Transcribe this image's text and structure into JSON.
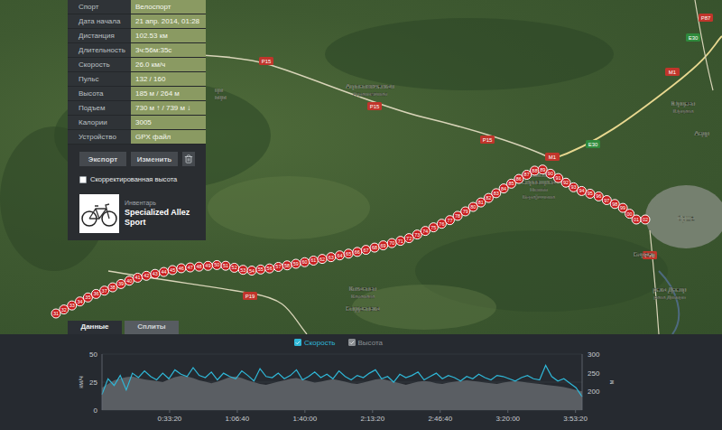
{
  "activity_panel": {
    "stats": [
      {
        "label": "Спорт",
        "value": "Велоспорт"
      },
      {
        "label": "Дата начала",
        "value": "21 апр. 2014, 01:28"
      },
      {
        "label": "Дистанция",
        "value": "102.53 км"
      },
      {
        "label": "Длительность",
        "value": "3ч:56м:35с"
      },
      {
        "label": "Скорость",
        "value": "26.0 км/ч"
      },
      {
        "label": "Пульс",
        "value": "132 / 160"
      },
      {
        "label": "Высота",
        "value": "185 м / 264 м"
      },
      {
        "label": "Подъем",
        "value": "730 м ↑ / 739 м ↓"
      },
      {
        "label": "Калории",
        "value": "3005"
      },
      {
        "label": "Устройство",
        "value": "GPX файл"
      }
    ],
    "buttons": [
      {
        "label": "Экспорт"
      },
      {
        "label": "Изменить"
      }
    ],
    "checkbox": {
      "label": "Скорректированная высота",
      "checked": false
    },
    "equipment": {
      "caption": "Инвентарь",
      "name": "Specialized Allez Sport"
    }
  },
  "map": {
    "markers": [
      "31",
      "32",
      "33",
      "34",
      "35",
      "36",
      "37",
      "38",
      "39",
      "40",
      "41",
      "42",
      "43",
      "44",
      "45",
      "46",
      "47",
      "48",
      "49",
      "50",
      "51",
      "52",
      "53",
      "54",
      "55",
      "56",
      "57",
      "58",
      "59",
      "60",
      "61",
      "62",
      "63",
      "64",
      "65",
      "66",
      "67",
      "68",
      "69",
      "70",
      "71",
      "72",
      "73",
      "74",
      "75",
      "76",
      "77",
      "78",
      "79",
      "80",
      "81",
      "82",
      "83",
      "84",
      "85",
      "86",
      "87",
      "88",
      "89",
      "90",
      "91",
      "92",
      "93",
      "94",
      "95",
      "96",
      "97",
      "98",
      "99",
      "00",
      "01",
      "02"
    ],
    "road_signs": [
      "P15",
      "P15",
      "P15",
      "P19",
      "M1",
      "M1",
      "E30",
      "E30",
      "P76",
      "P87"
    ],
    "places": [
      "Агрономическая",
      "Аграномічная",
      "Юрцево",
      "Юрцава",
      "Нижняя",
      "Вировщина",
      "Ніжняя",
      "Вераўшчына",
      "Коханово",
      "Каханава",
      "Богдановка",
      "Орша",
      "Барань",
      "река Днепр",
      "рака Дняпро",
      "Андр",
      "цы",
      "ьцы"
    ]
  },
  "tabs": [
    {
      "label": "Данные",
      "selected": true
    },
    {
      "label": "Сплиты",
      "selected": false
    }
  ],
  "chart": {
    "legend": [
      {
        "label": "Скорость",
        "checked": true,
        "color": "#2fb8d8"
      },
      {
        "label": "Высота",
        "checked": true,
        "color": "#8a8e92"
      }
    ],
    "left_axis": {
      "unit": "км/ч",
      "ticks": [
        "50",
        "25",
        "0"
      ]
    },
    "right_axis": {
      "unit": "м",
      "ticks": [
        "300",
        "250",
        "200"
      ]
    },
    "x_ticks": [
      "0:33:20",
      "1:06:40",
      "1:40:00",
      "2:13:20",
      "2:46:40",
      "3:20:00",
      "3:53:20"
    ],
    "speed": [
      14,
      28,
      22,
      31,
      18,
      33,
      29,
      35,
      30,
      27,
      33,
      28,
      36,
      32,
      30,
      38,
      31,
      29,
      34,
      27,
      33,
      30,
      28,
      35,
      31,
      26,
      37,
      30,
      29,
      33,
      28,
      31,
      36,
      27,
      30,
      34,
      29,
      32,
      28,
      35,
      30,
      27,
      31,
      29,
      33,
      36,
      28,
      30,
      25,
      32,
      29,
      31,
      34,
      27,
      30,
      33,
      28,
      31,
      29,
      26,
      30,
      28,
      32,
      29,
      27,
      31,
      30,
      28,
      26,
      29,
      31,
      28,
      27,
      40,
      30,
      26,
      28,
      24,
      20,
      12
    ],
    "elevation": [
      210,
      220,
      230,
      235,
      238,
      240,
      236,
      232,
      230,
      228,
      225,
      232,
      238,
      242,
      240,
      236,
      230,
      226,
      222,
      226,
      232,
      238,
      240,
      236,
      230,
      225,
      220,
      218,
      222,
      226,
      230,
      234,
      236,
      232,
      228,
      224,
      226,
      230,
      233,
      230,
      226,
      222,
      220,
      224,
      228,
      232,
      234,
      230,
      226,
      222,
      218,
      222,
      226,
      228,
      226,
      222,
      220,
      224,
      226,
      228,
      230,
      228,
      226,
      224,
      222,
      220,
      224,
      226,
      228,
      226,
      224,
      222,
      220,
      218,
      216,
      214,
      212,
      208,
      204,
      200
    ]
  }
}
